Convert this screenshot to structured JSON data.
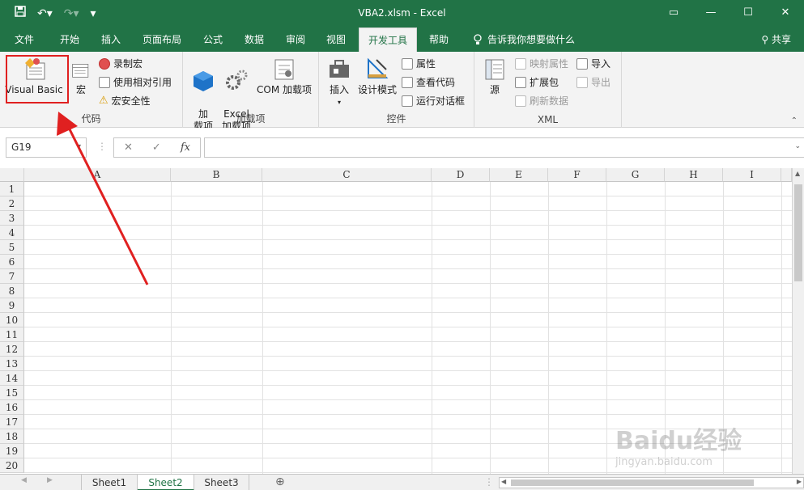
{
  "window": {
    "title": "VBA2.xlsm - Excel",
    "qat": {
      "save_icon": "save-icon",
      "undo_icon": "undo-icon",
      "redo_icon": "redo-icon",
      "customize": "▾"
    },
    "controls": {
      "ribbon_options": "▭",
      "minimize": "—",
      "restore": "☐",
      "close": "✕"
    }
  },
  "tabs": [
    {
      "label": "文件"
    },
    {
      "label": "开始"
    },
    {
      "label": "插入"
    },
    {
      "label": "页面布局"
    },
    {
      "label": "公式"
    },
    {
      "label": "数据"
    },
    {
      "label": "审阅"
    },
    {
      "label": "视图"
    },
    {
      "label": "开发工具",
      "active": true
    },
    {
      "label": "帮助"
    }
  ],
  "tell_me": "告诉我你想要做什么",
  "share": "共享",
  "ribbon": {
    "code": {
      "label": "代码",
      "visual_basic": "Visual Basic",
      "macros": "宏",
      "record_macro": "录制宏",
      "relative_refs": "使用相对引用",
      "macro_security": "宏安全性"
    },
    "addins": {
      "label": "加载项",
      "addins_btn": "加\n载项",
      "excel_addins": "Excel\n加载项",
      "com_addins": "COM 加载项"
    },
    "controls": {
      "label": "控件",
      "insert": "插入",
      "design_mode": "设计模式",
      "properties": "属性",
      "view_code": "查看代码",
      "run_dialog": "运行对话框"
    },
    "xml": {
      "label": "XML",
      "source": "源",
      "map_properties": "映射属性",
      "expansion_packs": "扩展包",
      "refresh_data": "刷新数据",
      "import": "导入",
      "export": "导出"
    }
  },
  "formula_bar": {
    "name_box": "G19",
    "cancel": "✕",
    "enter": "✓",
    "fx": "fx",
    "formula": ""
  },
  "columns": [
    "A",
    "B",
    "C",
    "D",
    "E",
    "F",
    "G",
    "H",
    "I"
  ],
  "rows": [
    "1",
    "2",
    "3",
    "4",
    "5",
    "6",
    "7",
    "8",
    "9",
    "10",
    "11",
    "12",
    "13",
    "14",
    "15",
    "16",
    "17",
    "18",
    "19",
    "20"
  ],
  "sheets": [
    {
      "label": "Sheet1"
    },
    {
      "label": "Sheet2",
      "active": true
    },
    {
      "label": "Sheet3"
    }
  ],
  "add_sheet": "⊕",
  "watermark": "Baidu经验",
  "watermark_url": "jingyan.baidu.com",
  "colors": {
    "excel_green": "#217346",
    "highlight_red": "#e02020"
  }
}
